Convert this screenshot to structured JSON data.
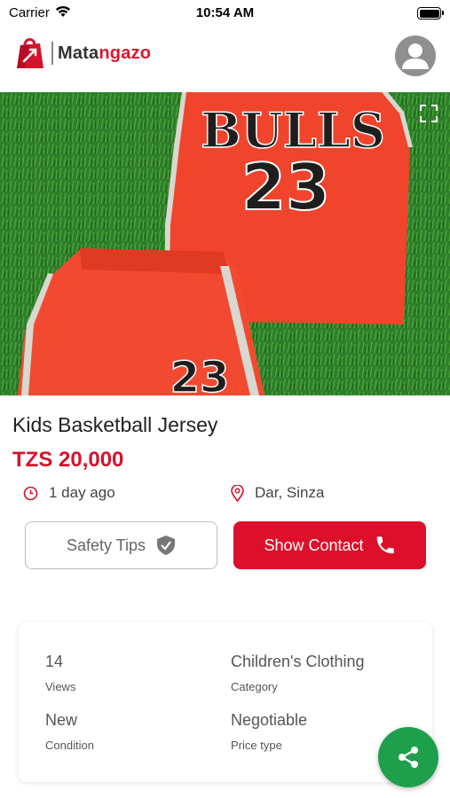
{
  "status_bar": {
    "carrier": "Carrier",
    "time": "10:54 AM"
  },
  "header": {
    "brand_part1": "Mata",
    "brand_part2": "ngazo"
  },
  "listing": {
    "title": "Kids Basketball Jersey",
    "price": "TZS 20,000",
    "posted": "1 day ago",
    "location": "Dar, Sinza",
    "jersey_team": "BULLS",
    "jersey_number": "23"
  },
  "actions": {
    "safety_tips": "Safety Tips",
    "show_contact": "Show Contact"
  },
  "details": {
    "views_value": "14",
    "views_label": "Views",
    "category_value": "Children's Clothing",
    "category_label": "Category",
    "condition_value": "New",
    "condition_label": "Condition",
    "price_type_value": "Negotiable",
    "price_type_label": "Price type"
  },
  "colors": {
    "brand_red": "#dd0f2a",
    "share_green": "#1e9f4c",
    "grass": "#2f7a2a",
    "jersey": "#f0442c"
  },
  "icons": [
    "wifi-icon",
    "battery-icon",
    "shopping-bag-icon",
    "user-icon",
    "expand-icon",
    "clock-icon",
    "location-pin-icon",
    "shield-check-icon",
    "phone-icon",
    "share-icon"
  ]
}
